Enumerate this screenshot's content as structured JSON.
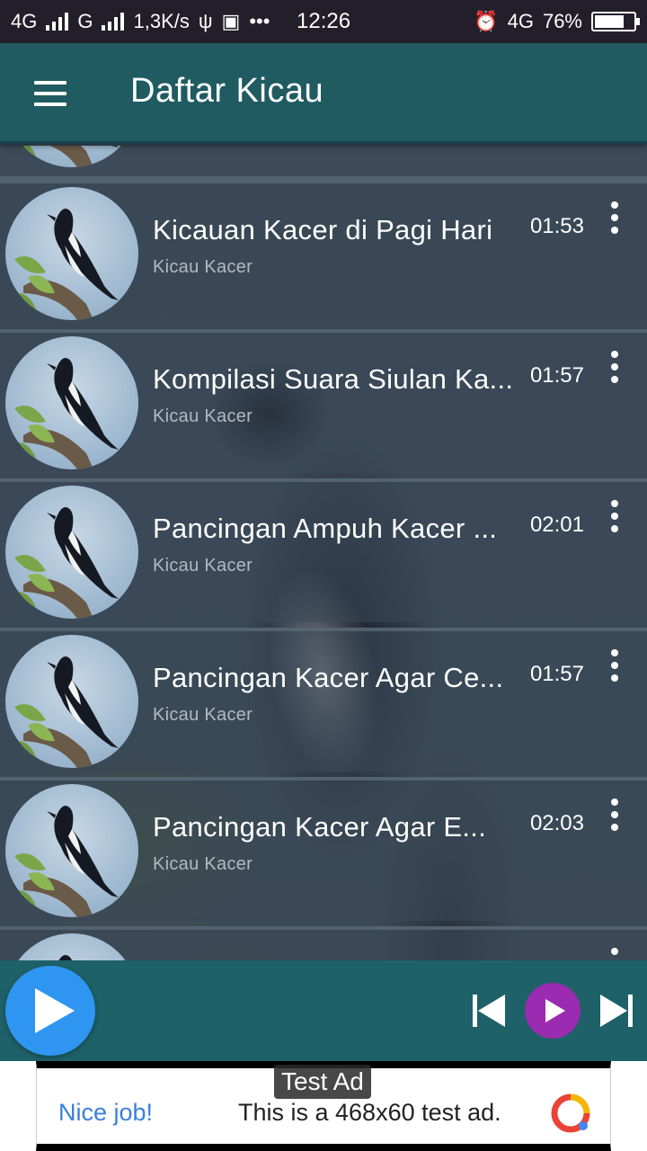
{
  "status_bar": {
    "network1": "4G",
    "network2": "G",
    "speed": "1,3K/s",
    "more": "•••",
    "time": "12:26",
    "network3": "4G",
    "battery": "76%",
    "battery_level": 0.76
  },
  "app_bar": {
    "title": "Daftar Kicau",
    "menu_icon": "hamburger-menu-icon"
  },
  "tracks": [
    {
      "title": "Kicauan Kacer di Pagi Hari",
      "artist": "Kicau Kacer",
      "duration": "01:53"
    },
    {
      "title": "Kompilasi Suara Siulan Ka...",
      "artist": "Kicau Kacer",
      "duration": "01:57"
    },
    {
      "title": "Pancingan Ampuh Kacer ...",
      "artist": "Kicau Kacer",
      "duration": "02:01"
    },
    {
      "title": "Pancingan Kacer Agar Ce...",
      "artist": "Kicau Kacer",
      "duration": "01:57"
    },
    {
      "title": "Pancingan Kacer Agar E...",
      "artist": "Kicau Kacer",
      "duration": "02:03"
    }
  ],
  "player": {
    "play_fab_icon": "play-icon",
    "prev_icon": "skip-previous-icon",
    "play_icon": "play-icon",
    "next_icon": "skip-next-icon",
    "play_color": "#9b2bb0",
    "fab_color": "#2e96f0"
  },
  "ad": {
    "tag": "Test Ad",
    "headline": "Nice job!",
    "body": "This is a 468x60 test ad."
  },
  "colors": {
    "app_bar": "#1f5b61",
    "player_bar": "#1e6169",
    "status_bar": "#231f2a"
  }
}
